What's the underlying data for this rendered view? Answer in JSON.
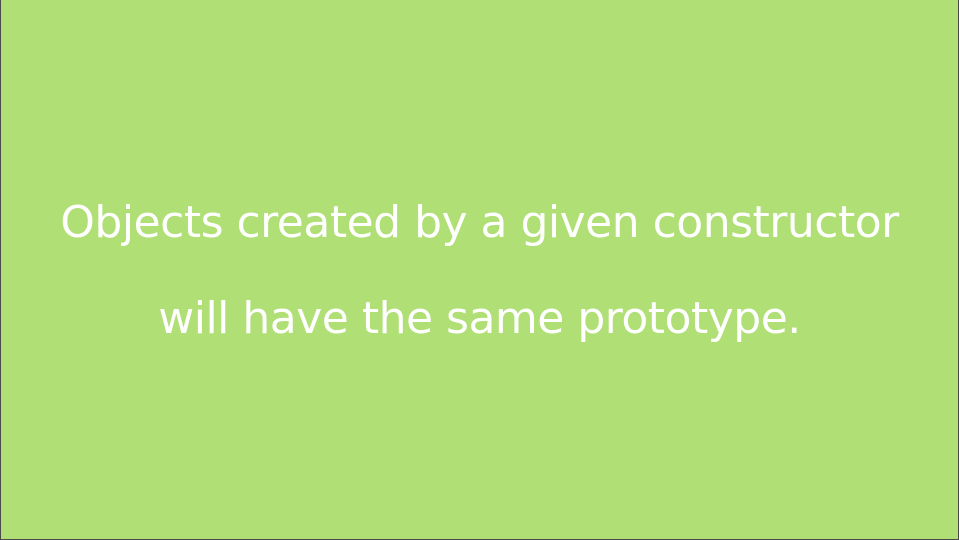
{
  "slide": {
    "background_color": "#afdf75",
    "text_color": "#ffffff",
    "lines": [
      "Objects created by a given constructor",
      "will have the same prototype."
    ]
  }
}
